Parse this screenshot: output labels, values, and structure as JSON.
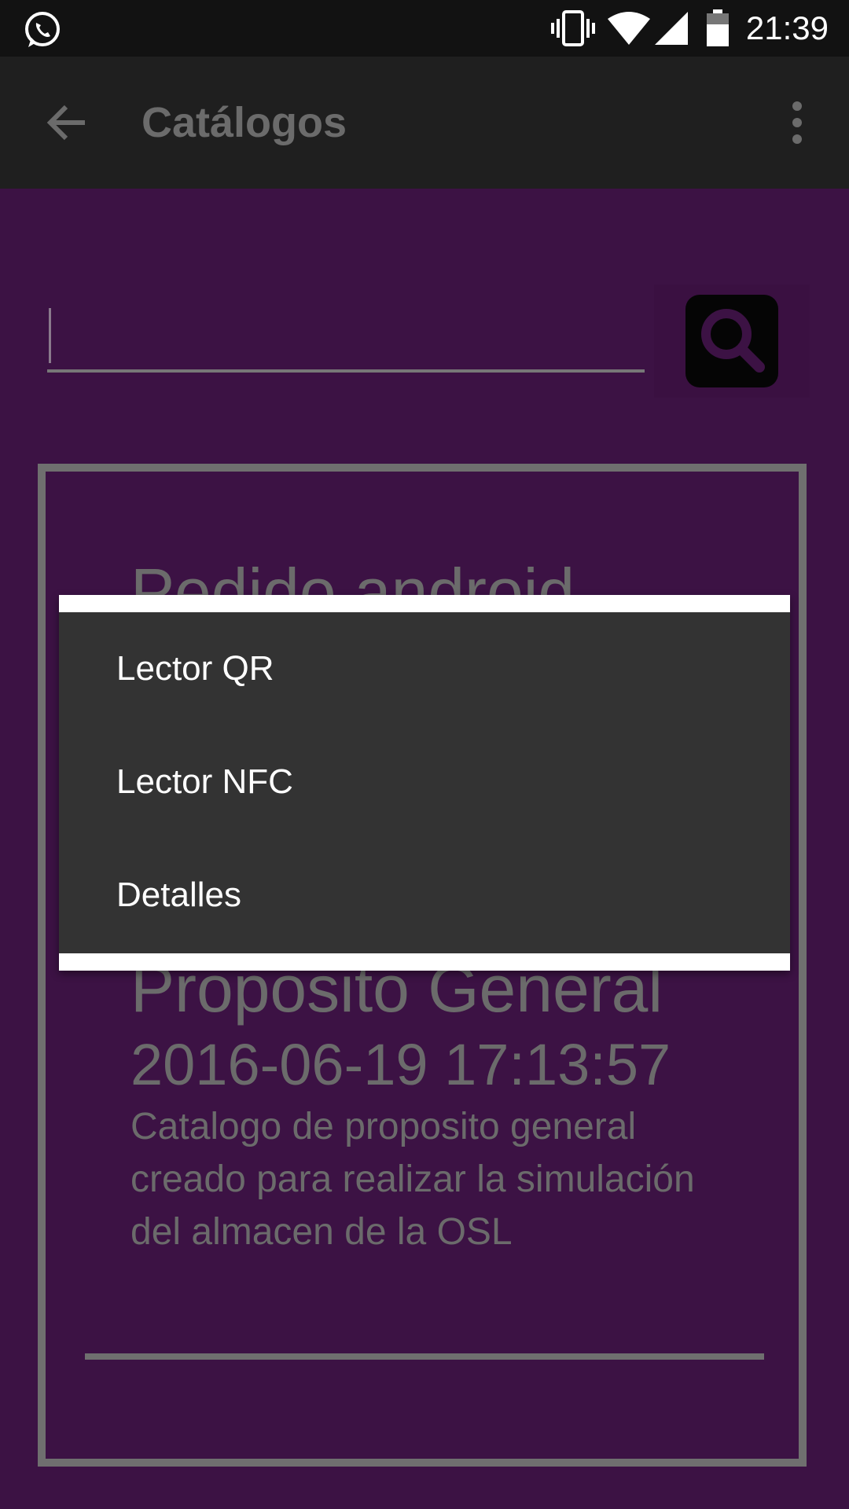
{
  "status_bar": {
    "time": "21:39",
    "icons": [
      "whatsapp-icon",
      "vibrate-icon",
      "wifi-icon",
      "signal-icon",
      "battery-icon"
    ]
  },
  "app_bar": {
    "title": "Catálogos",
    "back_icon": "arrow-back-icon",
    "overflow_icon": "more-vert-icon"
  },
  "search": {
    "value": "",
    "button_icon": "search-icon"
  },
  "catalog": {
    "name": "Pedido android",
    "type": "Proposito General",
    "date": "2016-06-19 17:13:57",
    "description": "Catalogo de proposito general creado para realizar la simulación del almacen de la OSL"
  },
  "overflow_menu": {
    "items": [
      {
        "label": "Lector QR"
      },
      {
        "label": "Lector NFC"
      },
      {
        "label": "Detalles"
      }
    ]
  },
  "colors": {
    "background": "#3c1244",
    "app_bar": "#1f1f1f",
    "status_bar": "#121212",
    "menu": "#333333"
  }
}
